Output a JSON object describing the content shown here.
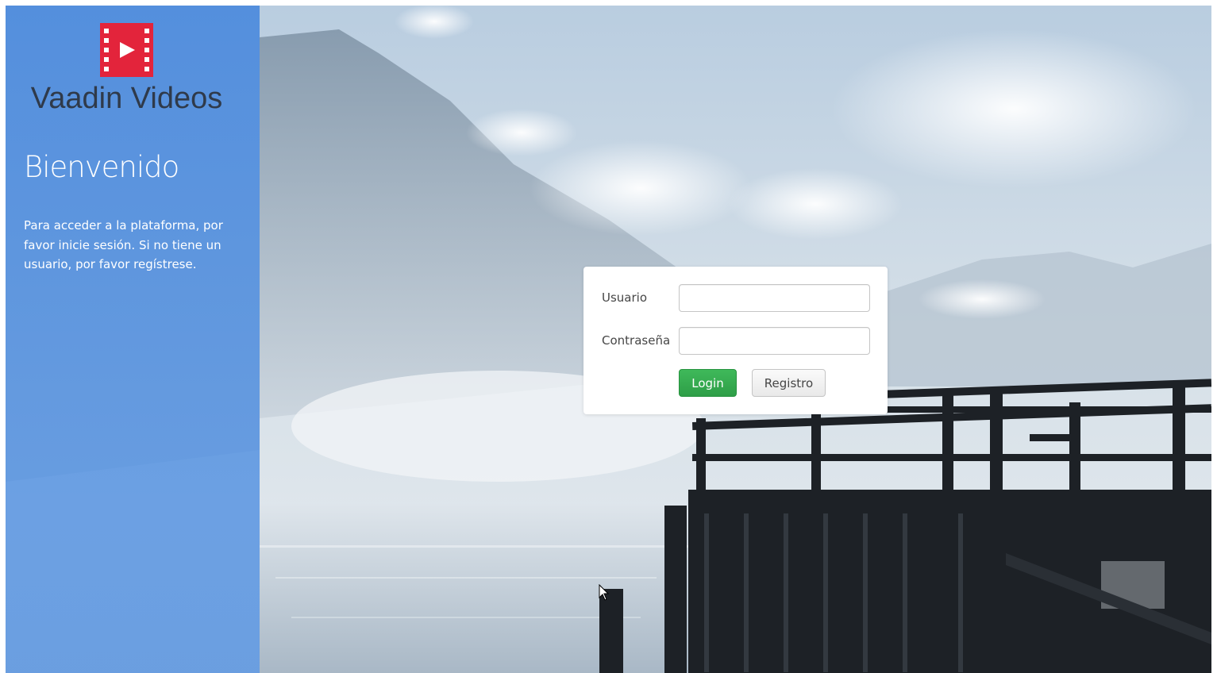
{
  "app": {
    "title": "Vaadin Videos",
    "logo_icon": "film-play-icon",
    "brand_color": "#e3243b"
  },
  "welcome": {
    "heading": "Bienvenido",
    "message": "Para acceder a la plataforma, por favor inicie sesión. Si no tiene un usuario, por favor regístrese."
  },
  "login_form": {
    "username_label": "Usuario",
    "username_value": "",
    "password_label": "Contraseña",
    "password_value": "",
    "login_button": "Login",
    "register_button": "Registro"
  },
  "colors": {
    "side_panel": "#4e8cde",
    "login_button": "#2e9e47"
  }
}
